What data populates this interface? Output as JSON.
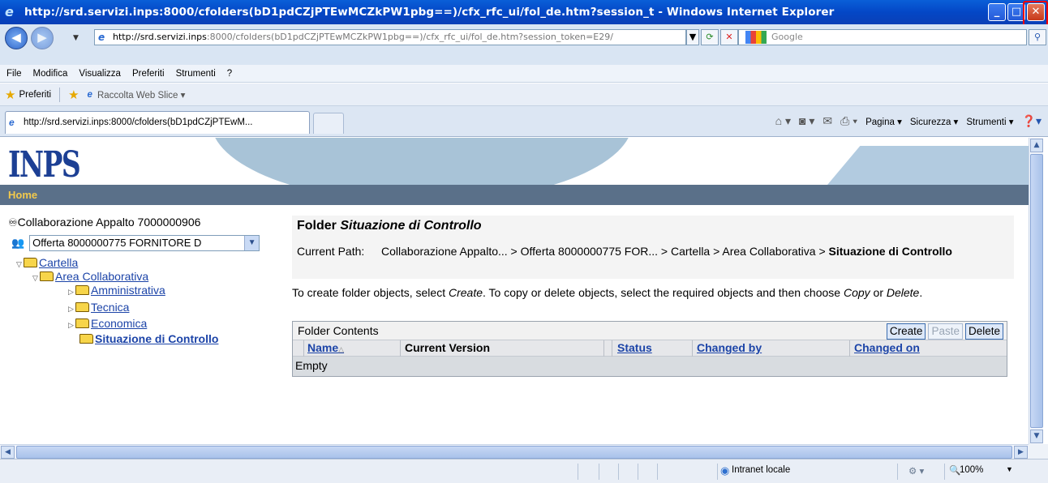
{
  "window": {
    "title": "http://srd.servizi.inps:8000/cfolders(bD1pdCZjPTEwMCZkPW1pbg==)/cfx_rfc_ui/fol_de.htm?session_t - Windows Internet Explorer",
    "minimize_glyph": "_",
    "maximize_glyph": "□",
    "close_glyph": "✕"
  },
  "address_bar": {
    "url_host": "http://srd.servizi.inps",
    "url_rest": ":8000/cfolders(bD1pdCZjPTEwMCZkPW1pbg==)/cfx_rfc_ui/fol_de.htm?session_token=E29/",
    "search_placeholder": "Google"
  },
  "menu": [
    "File",
    "Modifica",
    "Visualizza",
    "Preferiti",
    "Strumenti",
    "?"
  ],
  "favorites": {
    "label": "Preferiti",
    "webslice": "Raccolta Web Slice ▾"
  },
  "tab": {
    "label": "http://srd.servizi.inps:8000/cfolders(bD1pdCZjPTEwM..."
  },
  "command_bar": {
    "pagina": "Pagina ▾",
    "sicurezza": "Sicurezza ▾",
    "strumenti": "Strumenti ▾"
  },
  "page": {
    "logo": "INPS",
    "home": "Home",
    "tree": {
      "root": "Collaborazione Appalto 7000000906",
      "offer_select": "Offerta 8000000775 FORNITORE D",
      "cartella": "Cartella",
      "area": "Area Collaborativa",
      "amministrativa": "Amministrativa",
      "tecnica": "Tecnica",
      "economica": "Economica",
      "situazione": "Situazione di Controllo"
    },
    "folder_title_prefix": "Folder ",
    "folder_title_name": "Situazione di Controllo",
    "path_label": "Current Path:",
    "path_value": "Collaborazione Appalto... > Offerta 8000000775 FOR... > Cartella > Area Collaborativa > ",
    "path_current": "Situazione di Controllo",
    "instructions_1": "To create folder objects, select ",
    "instructions_create": "Create",
    "instructions_2": ". To copy or delete objects, select the required objects and then choose ",
    "instructions_copy": "Copy",
    "instructions_3": " or ",
    "instructions_delete": "Delete",
    "instructions_4": ".",
    "folder_contents": {
      "title": "Folder Contents",
      "buttons": {
        "create": "Create",
        "paste": "Paste",
        "delete": "Delete"
      },
      "columns": [
        "Name",
        "Current Version",
        "Status",
        "Changed by",
        "Changed on"
      ],
      "empty": "Empty"
    }
  },
  "status_bar": {
    "zone": "Intranet locale",
    "zoom": "100%"
  }
}
